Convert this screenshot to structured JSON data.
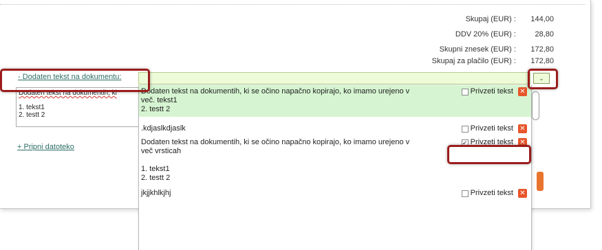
{
  "totals": [
    {
      "label": "Skupaj (EUR) :",
      "value": "144,00"
    },
    {
      "label": "DDV 20% (EUR) :",
      "value": "28,80"
    },
    {
      "label": "Skupni znesek (EUR) :",
      "value": "172,80"
    },
    {
      "label": "Skupaj za plačilo (EUR) :",
      "value": "172,80"
    }
  ],
  "document_text_link": "- Dodaten tekst na dokumentu:",
  "attach_link": "+ Pripni datoteko",
  "textarea": {
    "line1": "Dodaten tekst na dokumentih, ki",
    "line2": "1. tekst1",
    "line3": "2. testt 2"
  },
  "dropdown_toggle_icon": "chevron-down-icon",
  "dropdown_items": [
    {
      "text": "Dodaten tekst na dokumentih, ki se očino napačno kopirajo, ko imamo urejeno v\nveč. tekst1\n2. testt 2",
      "checkbox_label": "Privzeti tekst",
      "checked": false,
      "selected": true
    },
    {
      "text": ".kdjaslkdjaslk",
      "checkbox_label": "Privzeti tekst",
      "checked": false,
      "selected": false
    },
    {
      "text": "Dodaten tekst na dokumentih, ki se očino napačno kopirajo, ko imamo urejeno v\nveč vrsticah\n\n1. tekst1\n2. testt 2",
      "checkbox_label": "Privzeti tekst",
      "checked": true,
      "selected": false
    },
    {
      "text": "jkjjkhlkjhj",
      "checkbox_label": "Privzeti tekst",
      "checked": false,
      "selected": false
    }
  ],
  "delete_icon": "close-icon",
  "colors": {
    "accent_link": "#2c6e63",
    "highlight": "#9b1c1c",
    "delete": "#e8552a",
    "selected_bg": "#d6f4d1"
  }
}
